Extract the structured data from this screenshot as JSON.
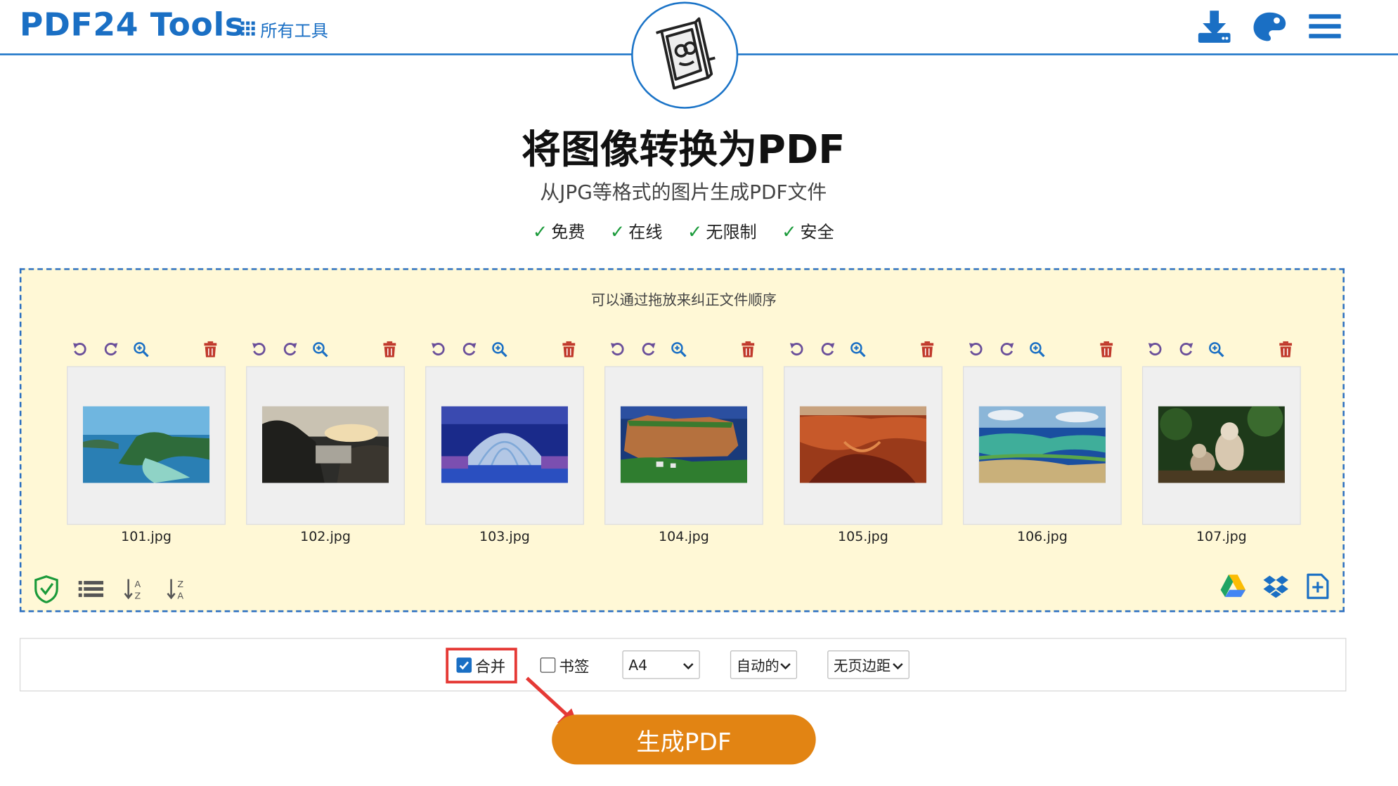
{
  "header": {
    "brand": "PDF24 Tools",
    "all_tools_label": "所有工具",
    "icons": [
      "grid-icon",
      "download-icon",
      "palette-icon",
      "menu-icon"
    ]
  },
  "hero": {
    "title": "将图像转换为PDF",
    "subtitle": "从JPG等格式的图片生成PDF文件",
    "features": [
      "免费",
      "在线",
      "无限制",
      "安全"
    ],
    "check_mark": "✓"
  },
  "dropzone": {
    "hint": "可以通过拖放来纠正文件顺序",
    "files": [
      {
        "name": "101.jpg",
        "thumb": "tropical-islands"
      },
      {
        "name": "102.jpg",
        "thumb": "rocky-coast-sunset"
      },
      {
        "name": "103.jpg",
        "thumb": "blue-shell-structure"
      },
      {
        "name": "104.jpg",
        "thumb": "sea-cliff-island"
      },
      {
        "name": "105.jpg",
        "thumb": "red-canyon"
      },
      {
        "name": "106.jpg",
        "thumb": "coastal-landscape"
      },
      {
        "name": "107.jpg",
        "thumb": "monkeys-forest"
      }
    ],
    "card_tool_icons": [
      "rotate-left-icon",
      "rotate-right-icon",
      "zoom-in-icon",
      "trash-icon"
    ],
    "bottom_left_icons": [
      "shield-check-icon",
      "list-view-icon",
      "sort-az-icon",
      "sort-za-icon"
    ],
    "bottom_right_icons": [
      "google-drive-icon",
      "dropbox-icon",
      "add-file-icon"
    ]
  },
  "options": {
    "merge": {
      "label": "合并",
      "checked": true
    },
    "bookmarks": {
      "label": "书签",
      "checked": false
    },
    "page_size": "A4",
    "orientation": "自动的",
    "margin": "无页边距"
  },
  "action": {
    "generate_label": "生成PDF"
  },
  "colors": {
    "brand_blue": "#1a6fc4",
    "dropzone_bg": "#fff8d6",
    "button_orange": "#e28413",
    "highlight_red": "#e53935",
    "icon_purple": "#6a4f9a",
    "trash_red": "#c0392b"
  }
}
